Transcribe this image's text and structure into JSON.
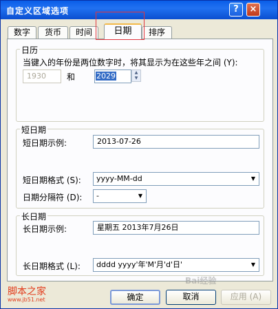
{
  "window": {
    "title": "自定义区域选项",
    "help_glyph": "?",
    "close_glyph": "×"
  },
  "tabs": [
    "数字",
    "货币",
    "时间",
    "日期",
    "排序"
  ],
  "calendar": {
    "group_title": "日历",
    "description": "当键入的年份是两位数字时，将其显示为在这些年之间 (Y):",
    "start_year": "1930",
    "and_label": "和",
    "end_year": "2029"
  },
  "short_date": {
    "group_title": "短日期",
    "sample_label": "短日期示例:",
    "sample_value": "2013-07-26",
    "format_label": "短日期格式 (S):",
    "format_value": "yyyy-MM-dd",
    "separator_label": "日期分隔符 (D):",
    "separator_value": "-"
  },
  "long_date": {
    "group_title": "长日期",
    "sample_label": "长日期示例:",
    "sample_value": "星期五 2013年7月26日",
    "format_label": "长日期格式 (L):",
    "format_value": "dddd yyyy'年'M'月'd'日'"
  },
  "buttons": {
    "ok": "确定",
    "cancel": "取消",
    "apply": "应用 (A)"
  },
  "watermark": {
    "site_name": "脚本之家",
    "url": "www.jb51.net",
    "baidu_mark": "Bai经验"
  },
  "colors": {
    "title_bar": "#0a5ee8",
    "highlight_box": "#e2353d",
    "selection": "#316ac5"
  }
}
